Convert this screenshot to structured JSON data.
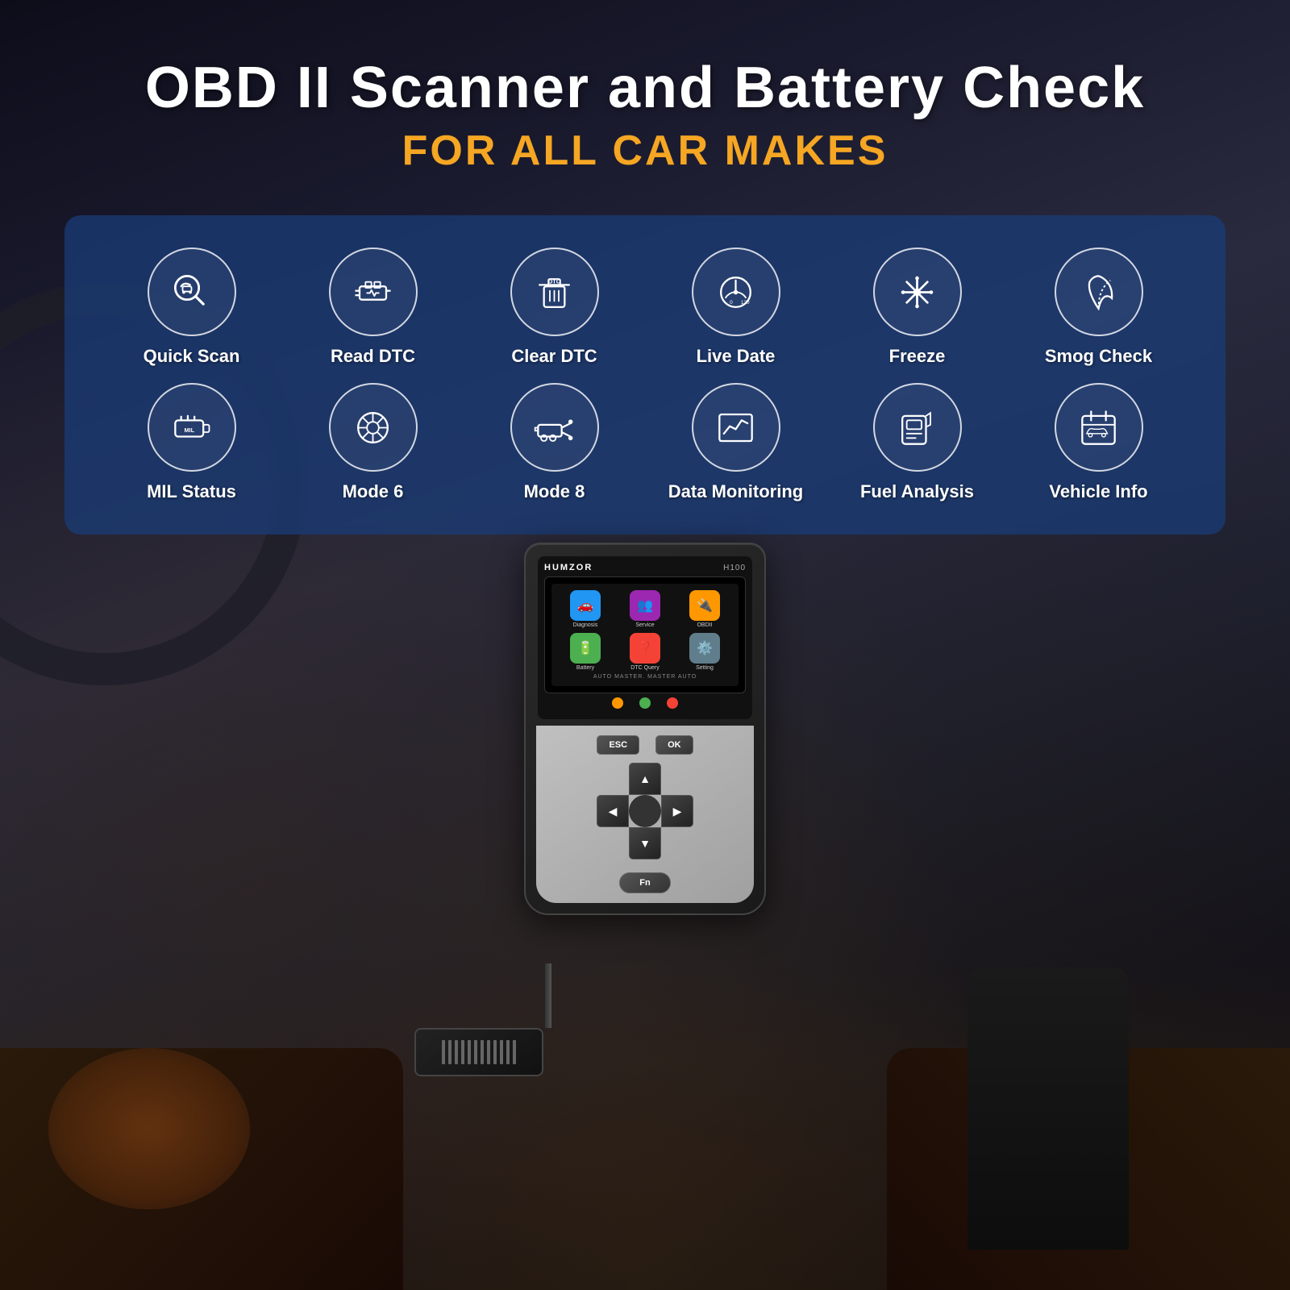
{
  "page": {
    "title": "OBD II Scanner and Battery Check",
    "subtitle": "FOR ALL CAR MAKES"
  },
  "features_row1": [
    {
      "id": "quick-scan",
      "label": "Quick Scan",
      "icon": "car-search"
    },
    {
      "id": "read-dtc",
      "label": "Read DTC",
      "icon": "engine"
    },
    {
      "id": "clear-dtc",
      "label": "Clear DTC",
      "icon": "trash-dtc"
    },
    {
      "id": "live-date",
      "label": "Live Date",
      "icon": "speedometer"
    },
    {
      "id": "freeze",
      "label": "Freeze",
      "icon": "snowflake"
    },
    {
      "id": "smog-check",
      "label": "Smog Check",
      "icon": "leaf"
    }
  ],
  "features_row2": [
    {
      "id": "mil-status",
      "label": "MIL Status",
      "icon": "engine-light"
    },
    {
      "id": "mode6",
      "label": "Mode 6",
      "icon": "aperture"
    },
    {
      "id": "mode8",
      "label": "Mode 8",
      "icon": "car-wrench"
    },
    {
      "id": "data-monitoring",
      "label": "Data Monitoring",
      "icon": "chart"
    },
    {
      "id": "fuel-analysis",
      "label": "Fuel Analysis",
      "icon": "fuel-gauge"
    },
    {
      "id": "vehicle-info",
      "label": "Vehicle Info",
      "icon": "calendar-car"
    }
  ],
  "device": {
    "brand": "HUMZOR",
    "model": "H100",
    "tagline": "AUTO MASTER. MASTER AUTO",
    "screen_apps": [
      {
        "label": "Diagnosis",
        "color": "#2196F3"
      },
      {
        "label": "Service",
        "color": "#9C27B0"
      },
      {
        "label": "OBDII",
        "color": "#FF9800"
      },
      {
        "label": "Battery",
        "color": "#4CAF50"
      },
      {
        "label": "DTC Query",
        "color": "#F44336"
      },
      {
        "label": "Setting",
        "color": "#607D8B"
      }
    ],
    "buttons": {
      "esc": "ESC",
      "ok": "OK",
      "fn": "Fn"
    }
  }
}
